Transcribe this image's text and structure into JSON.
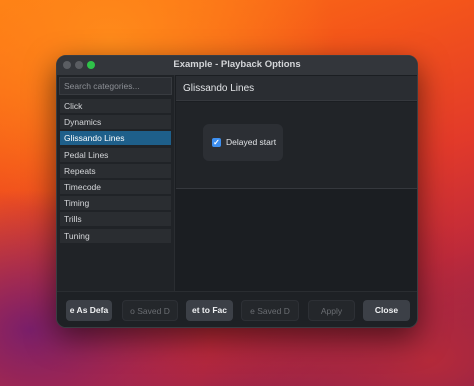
{
  "window": {
    "title": "Example - Playback Options"
  },
  "sidebar": {
    "search_placeholder": "Search categories...",
    "items": [
      {
        "label": "Click"
      },
      {
        "label": "Dynamics"
      },
      {
        "label": "Glissando Lines",
        "selected": true
      },
      {
        "label": "Pedal Lines"
      },
      {
        "label": "Repeats"
      },
      {
        "label": "Timecode"
      },
      {
        "label": "Timing"
      },
      {
        "label": "Trills"
      },
      {
        "label": "Tuning"
      }
    ]
  },
  "content": {
    "header": "Glissando Lines",
    "checkbox": {
      "label": "Delayed start",
      "checked": true
    }
  },
  "footer": {
    "buttons": [
      {
        "label": "e As Defa",
        "enabled": true
      },
      {
        "label": "o Saved D",
        "enabled": false
      },
      {
        "label": "et to Fac",
        "enabled": true
      },
      {
        "label": "e Saved D",
        "enabled": false
      },
      {
        "label": "Apply",
        "enabled": false
      },
      {
        "label": "Close",
        "enabled": true
      }
    ]
  },
  "colors": {
    "accent": "#1e5f8a",
    "checkbox": "#3d8ff0",
    "traffic_green": "#2fc249"
  }
}
